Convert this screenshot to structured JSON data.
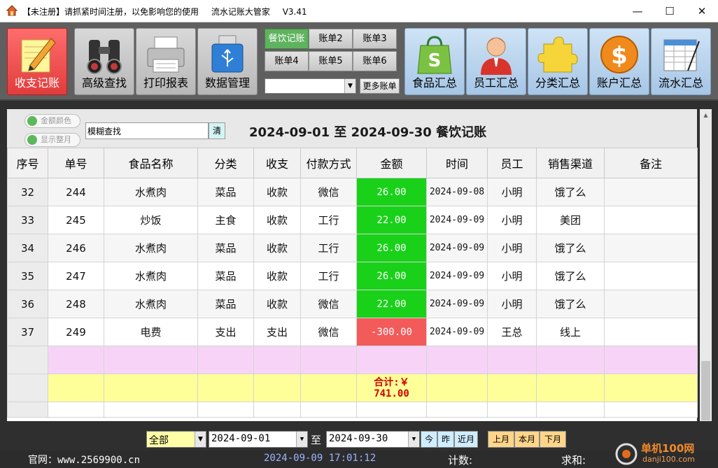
{
  "titlebar": {
    "unregistered": "【未注册】请抓紧时间注册，以免影响您的使用",
    "app_name": "流水记账大管家",
    "version": "V3.41",
    "minimize": "—",
    "maximize": "☐",
    "close": "✕"
  },
  "toolbar": {
    "buttons": [
      {
        "label": "收支记账",
        "icon": "pencil-notepad-icon"
      },
      {
        "label": "高级查找",
        "icon": "binoculars-icon"
      },
      {
        "label": "打印报表",
        "icon": "printer-icon"
      },
      {
        "label": "数据管理",
        "icon": "usb-drive-icon"
      }
    ],
    "ledgers": [
      "餐饮记账",
      "账单2",
      "账单3",
      "账单4",
      "账单5",
      "账单6"
    ],
    "ledger_select_value": "",
    "more_ledgers": "更多账单",
    "summaries": [
      {
        "label": "食品汇总",
        "icon": "shopping-bag-icon"
      },
      {
        "label": "员工汇总",
        "icon": "person-icon"
      },
      {
        "label": "分类汇总",
        "icon": "puzzle-icon"
      },
      {
        "label": "账户汇总",
        "icon": "dollar-coin-icon"
      },
      {
        "label": "流水汇总",
        "icon": "spreadsheet-icon"
      }
    ]
  },
  "panel": {
    "toggle_amount_color": "金额颜色",
    "toggle_show_whole_month": "显示整月",
    "search_value": "模糊查找",
    "clear_label": "清",
    "range_title": "2024-09-01  至  2024-09-30  餐饮记账"
  },
  "table": {
    "headers": [
      "序号",
      "单号",
      "食品名称",
      "分类",
      "收支",
      "付款方式",
      "金额",
      "时间",
      "员工",
      "销售渠道",
      "备注"
    ],
    "rows": [
      {
        "idx": "32",
        "no": "244",
        "name": "水煮肉",
        "cat": "菜品",
        "type": "收款",
        "pay": "微信",
        "amount": "26.00",
        "sign": "pos",
        "date": "2024-09-08",
        "staff": "小明",
        "channel": "饿了么",
        "note": ""
      },
      {
        "idx": "33",
        "no": "245",
        "name": "炒饭",
        "cat": "主食",
        "type": "收款",
        "pay": "工行",
        "amount": "22.00",
        "sign": "pos",
        "date": "2024-09-09",
        "staff": "小明",
        "channel": "美团",
        "note": ""
      },
      {
        "idx": "34",
        "no": "246",
        "name": "水煮肉",
        "cat": "菜品",
        "type": "收款",
        "pay": "工行",
        "amount": "26.00",
        "sign": "pos",
        "date": "2024-09-09",
        "staff": "小明",
        "channel": "饿了么",
        "note": ""
      },
      {
        "idx": "35",
        "no": "247",
        "name": "水煮肉",
        "cat": "菜品",
        "type": "收款",
        "pay": "工行",
        "amount": "26.00",
        "sign": "pos",
        "date": "2024-09-09",
        "staff": "小明",
        "channel": "饿了么",
        "note": ""
      },
      {
        "idx": "36",
        "no": "248",
        "name": "水煮肉",
        "cat": "菜品",
        "type": "收款",
        "pay": "微信",
        "amount": "22.00",
        "sign": "pos",
        "date": "2024-09-09",
        "staff": "小明",
        "channel": "饿了么",
        "note": ""
      },
      {
        "idx": "37",
        "no": "249",
        "name": "电费",
        "cat": "支出",
        "type": "支出",
        "pay": "微信",
        "amount": "-300.00",
        "sign": "neg",
        "date": "2024-09-09",
        "staff": "王总",
        "channel": "线上",
        "note": ""
      }
    ],
    "total_label": "合计:￥",
    "total_value": "741.00"
  },
  "filter": {
    "scope": "全部",
    "date_from": "2024-09-01",
    "to_label": "至",
    "date_to": "2024-09-30",
    "today": "今",
    "yesterday": "昨",
    "recent_month": "近月",
    "last_month": "上月",
    "this_month": "本月",
    "next_month": "下月"
  },
  "status": {
    "website": "官网：www.2569900.cn",
    "datetime": "2024-09-09 17:01:12",
    "count_label": "计数:",
    "sum_label": "求和:"
  },
  "watermark": {
    "text": "单机100网",
    "domain": "danji100.com"
  }
}
